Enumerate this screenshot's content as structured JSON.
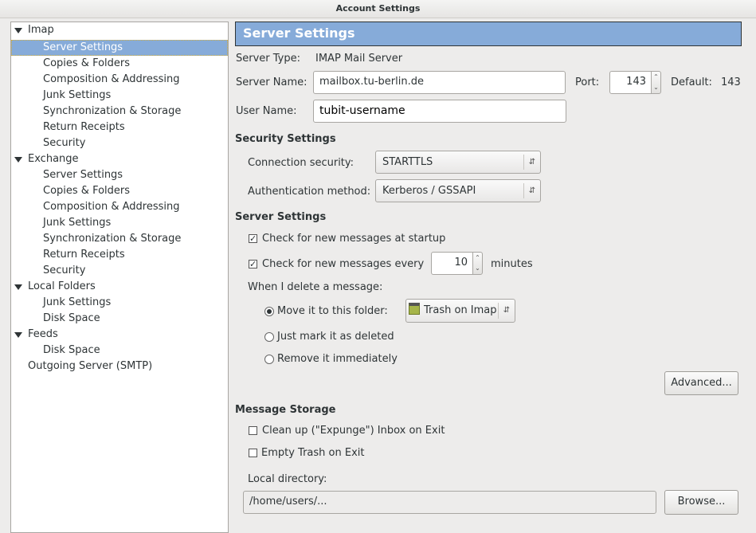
{
  "window": {
    "title": "Account Settings"
  },
  "sidebar": {
    "items": [
      {
        "label": "Imap",
        "level": 0,
        "expanded": true
      },
      {
        "label": "Server Settings",
        "level": 1,
        "selected": true
      },
      {
        "label": "Copies & Folders",
        "level": 1
      },
      {
        "label": "Composition & Addressing",
        "level": 1
      },
      {
        "label": "Junk Settings",
        "level": 1
      },
      {
        "label": "Synchronization & Storage",
        "level": 1
      },
      {
        "label": "Return Receipts",
        "level": 1
      },
      {
        "label": "Security",
        "level": 1
      },
      {
        "label": "Exchange",
        "level": 0,
        "expanded": true
      },
      {
        "label": "Server Settings",
        "level": 1
      },
      {
        "label": "Copies & Folders",
        "level": 1
      },
      {
        "label": "Composition & Addressing",
        "level": 1
      },
      {
        "label": "Junk Settings",
        "level": 1
      },
      {
        "label": "Synchronization & Storage",
        "level": 1
      },
      {
        "label": "Return Receipts",
        "level": 1
      },
      {
        "label": "Security",
        "level": 1
      },
      {
        "label": "Local Folders",
        "level": 0,
        "expanded": true
      },
      {
        "label": "Junk Settings",
        "level": 1
      },
      {
        "label": "Disk Space",
        "level": 1
      },
      {
        "label": "Feeds",
        "level": 0,
        "expanded": true
      },
      {
        "label": "Disk Space",
        "level": 1
      },
      {
        "label": "Outgoing Server (SMTP)",
        "level": 0,
        "expanded": false,
        "leaf": true
      }
    ]
  },
  "main": {
    "title": "Server Settings",
    "server_type_label": "Server Type:",
    "server_type_value": "IMAP Mail Server",
    "server_name_label": "Server Name:",
    "server_name_value": "mailbox.tu-berlin.de",
    "port_label": "Port:",
    "port_value": "143",
    "default_label": "Default:",
    "default_value": "143",
    "user_name_label": "User Name:",
    "user_name_value": "tubit-username",
    "security": {
      "heading": "Security Settings",
      "connection_label": "Connection security:",
      "connection_value": "STARTTLS",
      "auth_label": "Authentication method:",
      "auth_value": "Kerberos / GSSAPI"
    },
    "server": {
      "heading": "Server Settings",
      "check_startup_label": "Check for new messages at startup",
      "check_startup_checked": true,
      "check_every_label": "Check for new messages every",
      "check_every_checked": true,
      "check_every_value": "10",
      "minutes_label": "minutes",
      "delete_label": "When I delete a message:",
      "move_label": "Move it to this folder:",
      "move_selected": true,
      "folder_value": "Trash on Imap",
      "mark_label": "Just mark it as deleted",
      "remove_label": "Remove it immediately",
      "advanced_button": "Advanced..."
    },
    "storage": {
      "heading": "Message Storage",
      "expunge_label": "Clean up (\"Expunge\") Inbox on Exit",
      "expunge_checked": false,
      "empty_trash_label": "Empty Trash on Exit",
      "empty_trash_checked": false,
      "local_dir_label": "Local directory:",
      "local_dir_value": "/home/users/...",
      "browse_button": "Browse..."
    }
  },
  "colors": {
    "selection": "#86abd9",
    "header": "#86abd9",
    "background": "#edeceb"
  }
}
